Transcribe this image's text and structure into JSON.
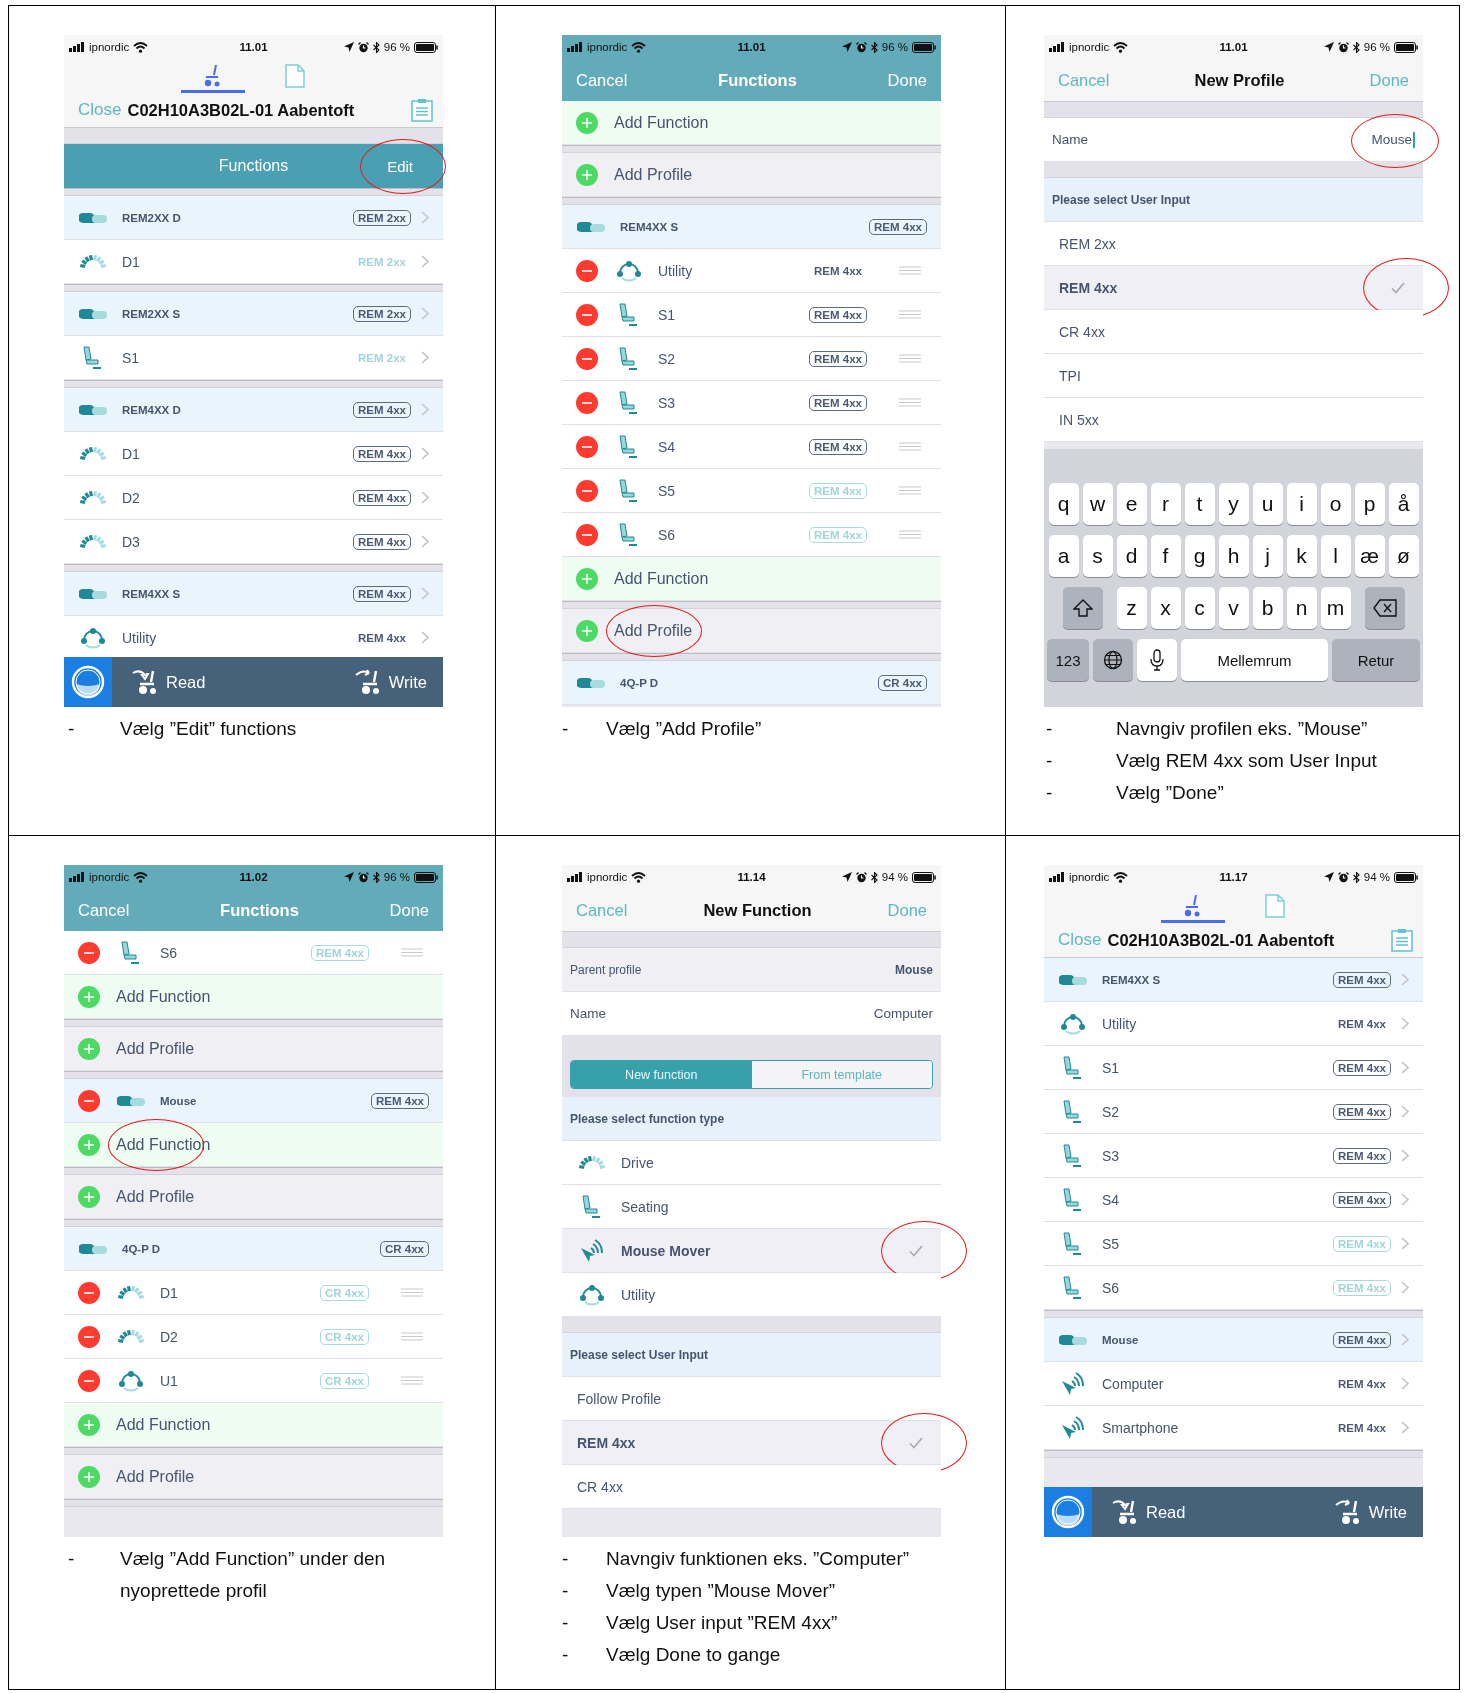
{
  "panels": [
    {
      "status": {
        "carrier": "ipnordic",
        "time": "11.01",
        "battery": "96 %"
      },
      "header": {
        "kind": "device",
        "tabs": [
          {
            "kind": "wheelchair",
            "selected": true
          },
          {
            "kind": "document",
            "selected": false
          }
        ],
        "close": "Close",
        "title": "C02H10A3B02L-01 Aabentoft"
      },
      "rows": [
        {
          "kind": "gap"
        },
        {
          "kind": "bar",
          "title": "Functions",
          "action": "Edit",
          "circled": true
        },
        {
          "kind": "divider"
        },
        {
          "kind": "profile",
          "name": "REM2XX D",
          "tag": {
            "text": "REM 2xx",
            "outlined": true,
            "dimmed": false
          },
          "remove_button": false,
          "editing": false
        },
        {
          "kind": "drive",
          "name": "D1",
          "tag": {
            "text": "REM 2xx",
            "outlined": false,
            "dimmed": true
          },
          "remove_button": false,
          "editing": false
        },
        {
          "kind": "divider"
        },
        {
          "kind": "profile",
          "name": "REM2XX S",
          "tag": {
            "text": "REM 2xx",
            "outlined": true,
            "dimmed": false
          },
          "remove_button": false,
          "editing": false
        },
        {
          "kind": "seat",
          "name": "S1",
          "tag": {
            "text": "REM 2xx",
            "outlined": false,
            "dimmed": true
          },
          "remove_button": false,
          "editing": false
        },
        {
          "kind": "divider"
        },
        {
          "kind": "profile",
          "name": "REM4XX D",
          "tag": {
            "text": "REM 4xx",
            "outlined": true,
            "dimmed": false
          },
          "remove_button": false,
          "editing": false
        },
        {
          "kind": "drive",
          "name": "D1",
          "tag": {
            "text": "REM 4xx",
            "outlined": true,
            "dimmed": false
          },
          "remove_button": false,
          "editing": false
        },
        {
          "kind": "drive",
          "name": "D2",
          "tag": {
            "text": "REM 4xx",
            "outlined": true,
            "dimmed": false
          },
          "remove_button": false,
          "editing": false
        },
        {
          "kind": "drive",
          "name": "D3",
          "tag": {
            "text": "REM 4xx",
            "outlined": true,
            "dimmed": false
          },
          "remove_button": false,
          "editing": false
        },
        {
          "kind": "divider"
        },
        {
          "kind": "profile",
          "name": "REM4XX S",
          "tag": {
            "text": "REM 4xx",
            "outlined": true,
            "dimmed": false
          },
          "remove_button": false,
          "editing": false
        },
        {
          "kind": "utility",
          "name": "Utility",
          "tag": {
            "text": "REM 4xx",
            "outlined": false,
            "dimmed": false
          },
          "remove_button": false,
          "editing": false
        }
      ],
      "bottom_bar": {
        "read": "Read",
        "write": "Write"
      },
      "captions": [
        {
          "bullet": "-",
          "text": "Vælg ”Edit” functions"
        }
      ]
    },
    {
      "status": {
        "carrier": "ipnordic",
        "time": "11.01",
        "battery": "96 %"
      },
      "header": {
        "kind": "nav",
        "tinted": true,
        "cancel": "Cancel",
        "title": "Functions",
        "done": "Done"
      },
      "rows": [
        {
          "kind": "add-function",
          "label": "Add Function",
          "circled": false
        },
        {
          "kind": "divider"
        },
        {
          "kind": "add-profile",
          "label": "Add Profile",
          "circled": false
        },
        {
          "kind": "divider"
        },
        {
          "kind": "profile",
          "name": "REM4XX S",
          "tag": {
            "text": "REM 4xx",
            "outlined": true,
            "dimmed": false
          },
          "remove_button": false,
          "editing": true
        },
        {
          "kind": "utility",
          "name": "Utility",
          "tag": {
            "text": "REM 4xx",
            "outlined": false,
            "dimmed": false
          },
          "remove_button": true,
          "editing": true
        },
        {
          "kind": "seat",
          "name": "S1",
          "tag": {
            "text": "REM 4xx",
            "outlined": true,
            "dimmed": false
          },
          "remove_button": true,
          "editing": true
        },
        {
          "kind": "seat",
          "name": "S2",
          "tag": {
            "text": "REM 4xx",
            "outlined": true,
            "dimmed": false
          },
          "remove_button": true,
          "editing": true
        },
        {
          "kind": "seat",
          "name": "S3",
          "tag": {
            "text": "REM 4xx",
            "outlined": true,
            "dimmed": false
          },
          "remove_button": true,
          "editing": true
        },
        {
          "kind": "seat",
          "name": "S4",
          "tag": {
            "text": "REM 4xx",
            "outlined": true,
            "dimmed": false
          },
          "remove_button": true,
          "editing": true
        },
        {
          "kind": "seat",
          "name": "S5",
          "tag": {
            "text": "REM 4xx",
            "outlined": true,
            "dimmed": true
          },
          "remove_button": true,
          "editing": true
        },
        {
          "kind": "seat",
          "name": "S6",
          "tag": {
            "text": "REM 4xx",
            "outlined": true,
            "dimmed": true
          },
          "remove_button": true,
          "editing": true
        },
        {
          "kind": "add-function",
          "label": "Add Function",
          "circled": false
        },
        {
          "kind": "divider"
        },
        {
          "kind": "add-profile",
          "label": "Add Profile",
          "circled": true
        },
        {
          "kind": "divider"
        },
        {
          "kind": "profile",
          "name": "4Q-P D",
          "tag": {
            "text": "CR 4xx",
            "outlined": true,
            "dimmed": false
          },
          "remove_button": false,
          "editing": true
        }
      ],
      "captions": [
        {
          "bullet": "-",
          "text": "Vælg ”Add Profile”"
        }
      ]
    },
    {
      "status": {
        "carrier": "ipnordic",
        "time": "11.01",
        "battery": "96 %"
      },
      "header": {
        "kind": "nav",
        "tinted": false,
        "cancel": "Cancel",
        "title": "New Profile",
        "done": "Done"
      },
      "rows": [
        {
          "kind": "gap"
        },
        {
          "kind": "field",
          "label": "Name",
          "value": "Mouse",
          "cursor": true,
          "shaded": false,
          "circled": true
        },
        {
          "kind": "gap"
        },
        {
          "kind": "section",
          "label": "Please select User Input"
        },
        {
          "kind": "option",
          "label": "REM 2xx",
          "selected": false,
          "circled": false
        },
        {
          "kind": "option",
          "label": "REM 4xx",
          "selected": true,
          "circled": true
        },
        {
          "kind": "option",
          "label": "CR 4xx",
          "selected": false,
          "circled": false
        },
        {
          "kind": "option",
          "label": "TPI",
          "selected": false,
          "circled": false
        },
        {
          "kind": "option",
          "label": "IN 5xx",
          "selected": false,
          "circled": false
        }
      ],
      "keyboard": {
        "rows": [
          {
            "kind": "letters",
            "keys": [
              "q",
              "w",
              "e",
              "r",
              "t",
              "y",
              "u",
              "i",
              "o",
              "p",
              "å"
            ]
          },
          {
            "kind": "letters",
            "keys": [
              "a",
              "s",
              "d",
              "f",
              "g",
              "h",
              "j",
              "k",
              "l",
              "æ",
              "ø"
            ]
          },
          {
            "kind": "shift-row",
            "keys": [
              "z",
              "x",
              "c",
              "v",
              "b",
              "n",
              "m"
            ]
          }
        ],
        "bottom": [
          {
            "kind": "numbers",
            "label": "123"
          },
          {
            "kind": "globe"
          },
          {
            "kind": "mic"
          },
          {
            "kind": "space",
            "label": "Mellemrum"
          },
          {
            "kind": "return",
            "label": "Retur"
          }
        ]
      },
      "captions": [
        {
          "bullet": "-",
          "text": "Navngiv profilen eks. ”Mouse”"
        },
        {
          "bullet": "-",
          "text": "Vælg REM 4xx som User Input"
        },
        {
          "bullet": "-",
          "text": "Vælg ”Done”"
        }
      ]
    },
    {
      "status": {
        "carrier": "ipnordic",
        "time": "11.02",
        "battery": "96 %"
      },
      "header": {
        "kind": "nav",
        "tinted": true,
        "cancel": "Cancel",
        "title": "Functions",
        "done": "Done"
      },
      "rows": [
        {
          "kind": "seat",
          "name": "S6",
          "tag": {
            "text": "REM 4xx",
            "outlined": true,
            "dimmed": true
          },
          "remove_button": true,
          "editing": true
        },
        {
          "kind": "add-function",
          "label": "Add Function",
          "circled": false
        },
        {
          "kind": "divider"
        },
        {
          "kind": "add-profile",
          "label": "Add Profile",
          "circled": false
        },
        {
          "kind": "divider"
        },
        {
          "kind": "profile",
          "name": "Mouse",
          "tag": {
            "text": "REM 4xx",
            "outlined": true,
            "dimmed": false
          },
          "remove_button": true,
          "editing": true
        },
        {
          "kind": "add-function",
          "label": "Add Function",
          "circled": true
        },
        {
          "kind": "divider"
        },
        {
          "kind": "add-profile",
          "label": "Add Profile",
          "circled": false
        },
        {
          "kind": "divider"
        },
        {
          "kind": "profile",
          "name": "4Q-P D",
          "tag": {
            "text": "CR 4xx",
            "outlined": true,
            "dimmed": false
          },
          "remove_button": false,
          "editing": true
        },
        {
          "kind": "drive",
          "name": "D1",
          "tag": {
            "text": "CR 4xx",
            "outlined": true,
            "dimmed": true
          },
          "remove_button": true,
          "editing": true
        },
        {
          "kind": "drive",
          "name": "D2",
          "tag": {
            "text": "CR 4xx",
            "outlined": true,
            "dimmed": true
          },
          "remove_button": true,
          "editing": true
        },
        {
          "kind": "utility",
          "name": "U1",
          "tag": {
            "text": "CR 4xx",
            "outlined": true,
            "dimmed": true
          },
          "remove_button": true,
          "editing": true
        },
        {
          "kind": "add-function",
          "label": "Add Function",
          "circled": false
        },
        {
          "kind": "divider"
        },
        {
          "kind": "add-profile",
          "label": "Add Profile",
          "circled": false
        },
        {
          "kind": "divider"
        }
      ],
      "captions": [
        {
          "bullet": "-",
          "text": "Vælg ”Add Function” under den nyoprettede profil"
        }
      ]
    },
    {
      "status": {
        "carrier": "ipnordic",
        "time": "11.14",
        "battery": "94 %"
      },
      "header": {
        "kind": "nav",
        "tinted": false,
        "cancel": "Cancel",
        "title": "New Function",
        "done": "Done"
      },
      "rows": [
        {
          "kind": "gap"
        },
        {
          "kind": "field",
          "label": "Parent profile",
          "value": "Mouse",
          "cursor": false,
          "shaded": true,
          "circled": false
        },
        {
          "kind": "field",
          "label": "Name",
          "value": "Computer",
          "cursor": false,
          "shaded": false,
          "circled": false
        },
        {
          "kind": "segmented",
          "segments": [
            {
              "label": "New function",
              "selected": true
            },
            {
              "label": "From template",
              "selected": false
            }
          ]
        },
        {
          "kind": "section",
          "label": "Please select function type"
        },
        {
          "kind": "drive",
          "label": "Drive",
          "selected": false,
          "circled": false
        },
        {
          "kind": "seat",
          "label": "Seating",
          "selected": false,
          "circled": false
        },
        {
          "kind": "mouse",
          "label": "Mouse Mover",
          "selected": true,
          "circled": true
        },
        {
          "kind": "utility",
          "label": "Utility",
          "selected": false,
          "circled": false
        },
        {
          "kind": "gap"
        },
        {
          "kind": "section",
          "label": "Please select User Input"
        },
        {
          "kind": "option",
          "label": "Follow Profile",
          "selected": false,
          "circled": false
        },
        {
          "kind": "option",
          "label": "REM 4xx",
          "selected": true,
          "circled": true
        },
        {
          "kind": "option",
          "label": "CR 4xx",
          "selected": false,
          "circled": false
        }
      ],
      "captions": [
        {
          "bullet": "-",
          "text": "Navngiv funktionen eks. ”Computer”"
        },
        {
          "bullet": "-",
          "text": "Vælg typen ”Mouse Mover”"
        },
        {
          "bullet": "-",
          "text": "Vælg User input ”REM 4xx”"
        },
        {
          "bullet": "-",
          "text": "Vælg Done to gange"
        }
      ]
    },
    {
      "status": {
        "carrier": "ipnordic",
        "time": "11.17",
        "battery": "94 %"
      },
      "header": {
        "kind": "device",
        "tabs": [
          {
            "kind": "wheelchair",
            "selected": true
          },
          {
            "kind": "document",
            "selected": false
          }
        ],
        "close": "Close",
        "title": "C02H10A3B02L-01 Aabentoft"
      },
      "rows": [
        {
          "kind": "profile",
          "name": "REM4XX S",
          "tag": {
            "text": "REM 4xx",
            "outlined": true,
            "dimmed": false
          },
          "remove_button": false,
          "editing": false
        },
        {
          "kind": "utility",
          "name": "Utility",
          "tag": {
            "text": "REM 4xx",
            "outlined": false,
            "dimmed": false
          },
          "remove_button": false,
          "editing": false
        },
        {
          "kind": "seat",
          "name": "S1",
          "tag": {
            "text": "REM 4xx",
            "outlined": true,
            "dimmed": false
          },
          "remove_button": false,
          "editing": false
        },
        {
          "kind": "seat",
          "name": "S2",
          "tag": {
            "text": "REM 4xx",
            "outlined": true,
            "dimmed": false
          },
          "remove_button": false,
          "editing": false
        },
        {
          "kind": "seat",
          "name": "S3",
          "tag": {
            "text": "REM 4xx",
            "outlined": true,
            "dimmed": false
          },
          "remove_button": false,
          "editing": false
        },
        {
          "kind": "seat",
          "name": "S4",
          "tag": {
            "text": "REM 4xx",
            "outlined": true,
            "dimmed": false
          },
          "remove_button": false,
          "editing": false
        },
        {
          "kind": "seat",
          "name": "S5",
          "tag": {
            "text": "REM 4xx",
            "outlined": true,
            "dimmed": true
          },
          "remove_button": false,
          "editing": false
        },
        {
          "kind": "seat",
          "name": "S6",
          "tag": {
            "text": "REM 4xx",
            "outlined": true,
            "dimmed": true
          },
          "remove_button": false,
          "editing": false
        },
        {
          "kind": "divider"
        },
        {
          "kind": "profile",
          "name": "Mouse",
          "tag": {
            "text": "REM 4xx",
            "outlined": true,
            "dimmed": false
          },
          "remove_button": false,
          "editing": false
        },
        {
          "kind": "mouse",
          "name": "Computer",
          "tag": {
            "text": "REM 4xx",
            "outlined": false,
            "dimmed": false
          },
          "remove_button": false,
          "editing": false
        },
        {
          "kind": "mouse",
          "name": "Smartphone",
          "tag": {
            "text": "REM 4xx",
            "outlined": false,
            "dimmed": false
          },
          "remove_button": false,
          "editing": false
        },
        {
          "kind": "divider"
        }
      ],
      "bottom_bar": {
        "read": "Read",
        "write": "Write"
      }
    }
  ]
}
